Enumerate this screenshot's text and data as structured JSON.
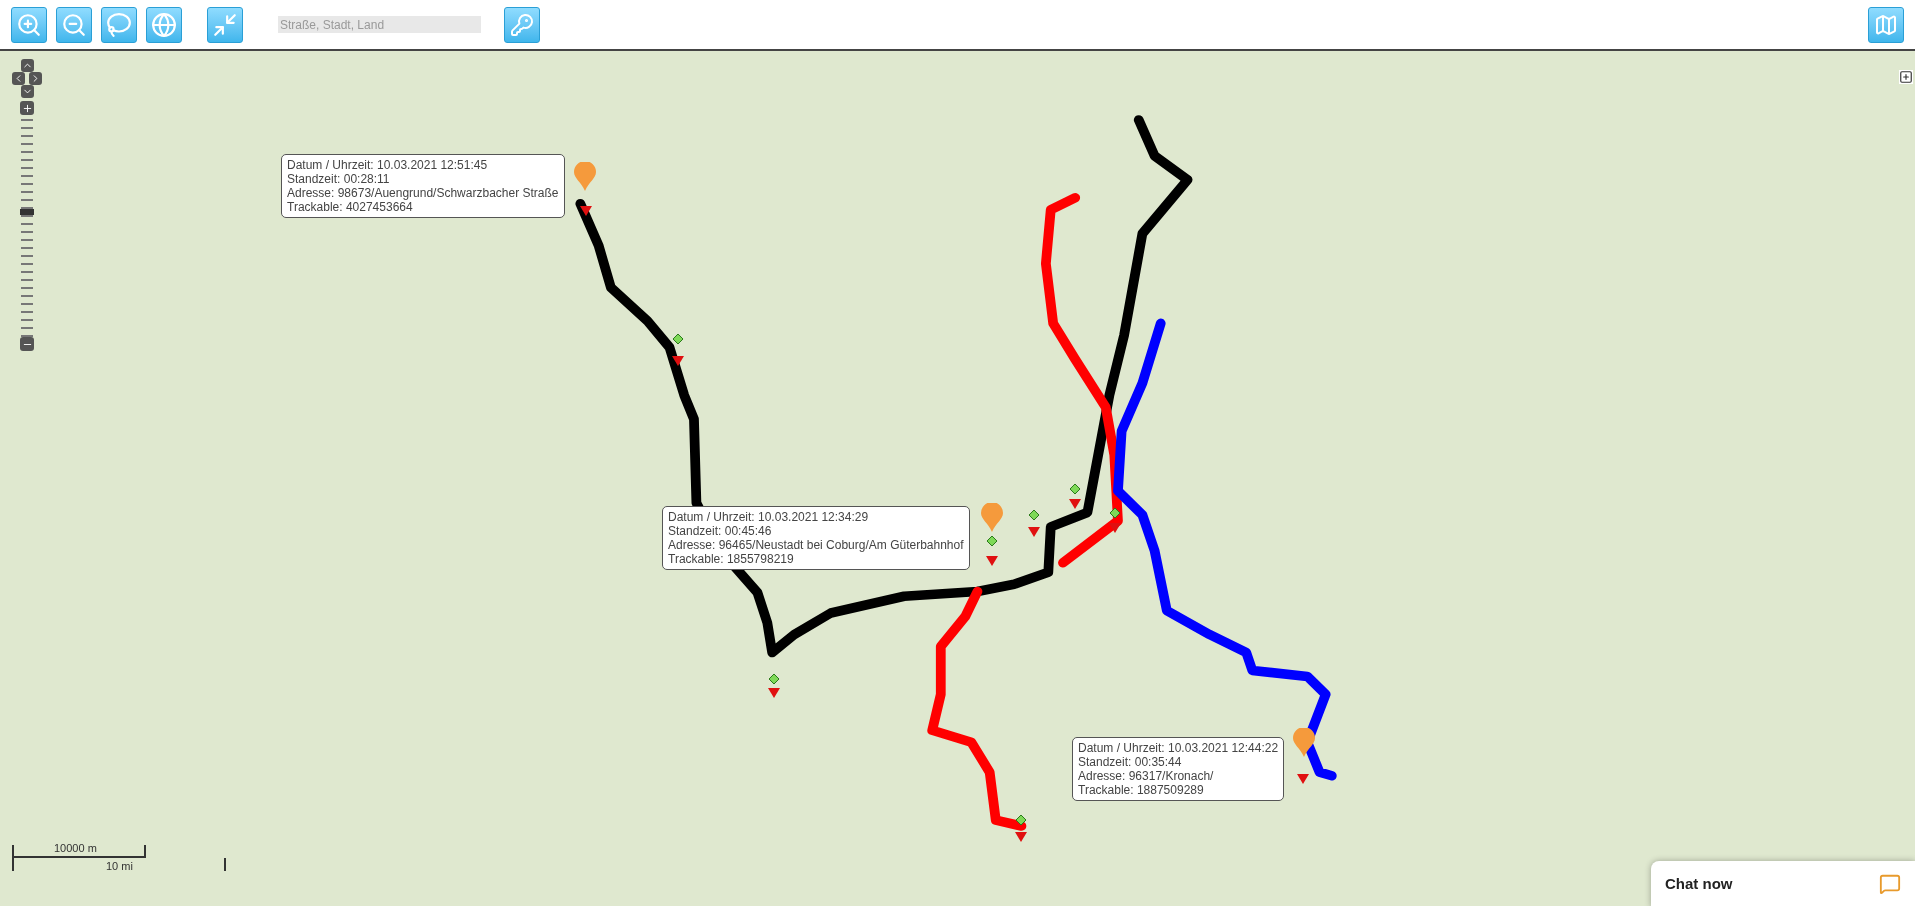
{
  "search": {
    "placeholder": "Straße, Stadt, Land"
  },
  "popups": [
    {
      "lines": [
        "Datum / Uhrzeit: 10.03.2021 12:51:45",
        "Standzeit: 00:28:11",
        "Adresse: 98673/Auengrund/Schwarzbacher Straße",
        "Trackable: 4027453664"
      ]
    },
    {
      "lines": [
        "Datum / Uhrzeit: 10.03.2021 12:34:29",
        "Standzeit: 00:45:46",
        "Adresse: 96465/Neustadt bei Coburg/Am Güterbahnhof",
        "Trackable: 1855798219"
      ]
    },
    {
      "lines": [
        "Datum / Uhrzeit: 10.03.2021 12:44:22",
        "Standzeit: 00:35:44",
        "Adresse: 96317/Kronach/",
        "Trackable: 1887509289"
      ]
    }
  ],
  "scale": {
    "metric": "10000 m",
    "imperial": "10 mi"
  },
  "chat": {
    "label": "Chat now"
  }
}
